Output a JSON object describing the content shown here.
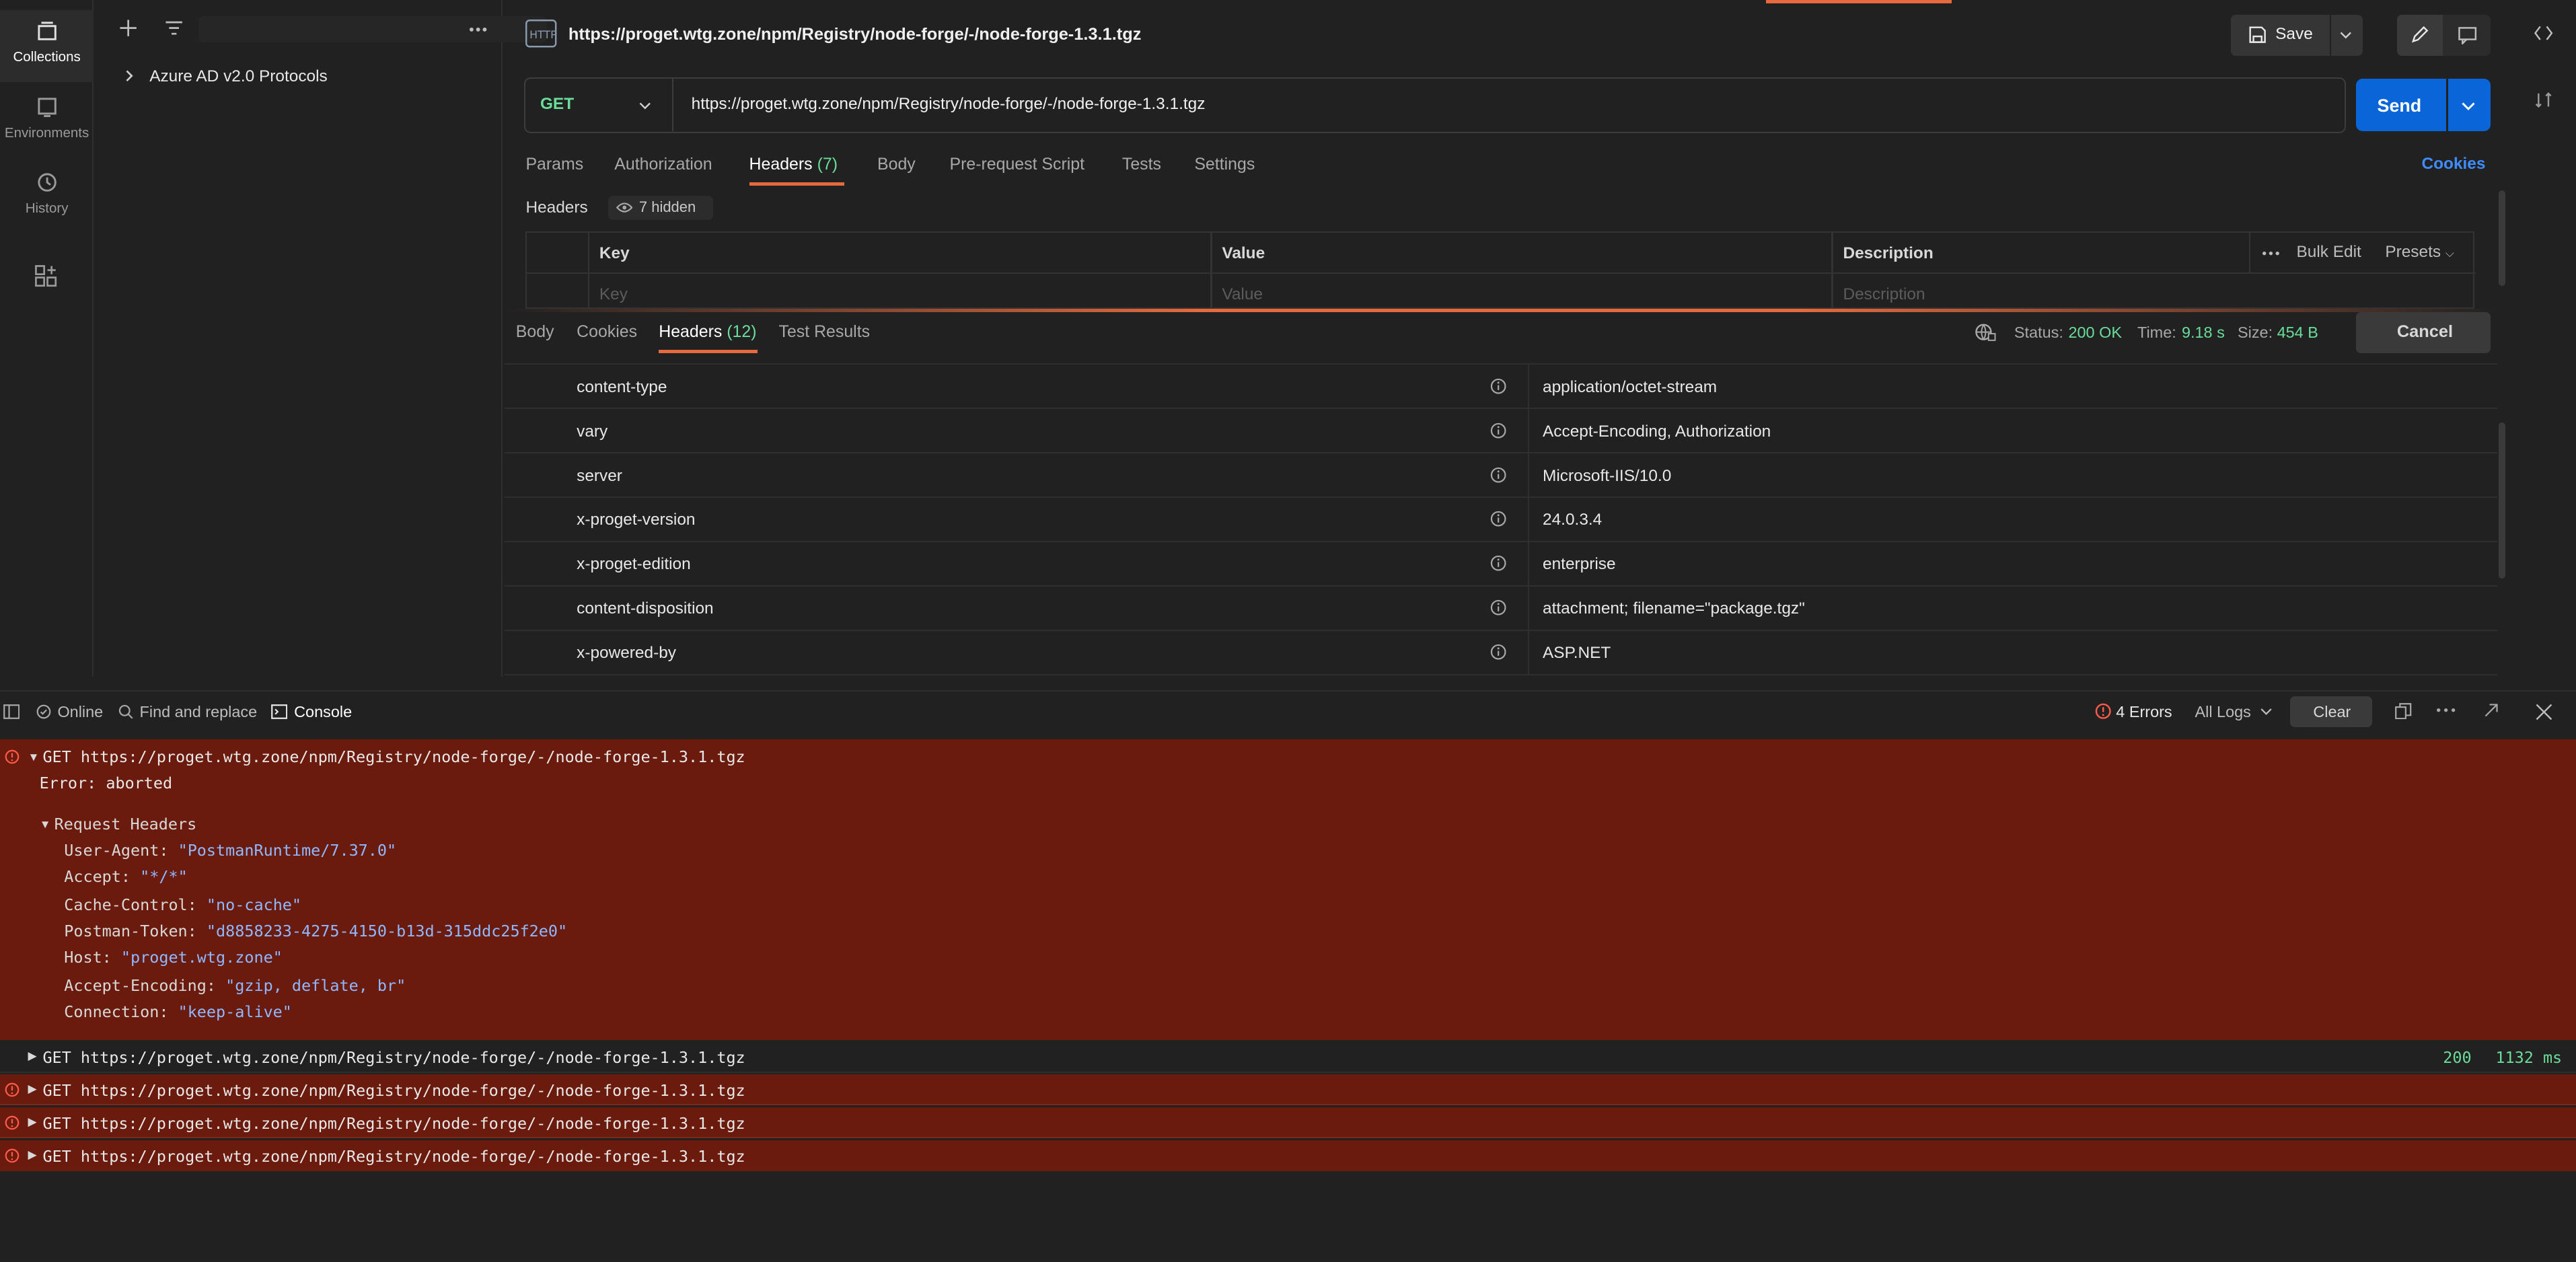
{
  "nav": {
    "items": [
      {
        "label": "Collections",
        "icon": "collections-icon",
        "active": true
      },
      {
        "label": "Environments",
        "icon": "environments-icon",
        "active": false
      },
      {
        "label": "History",
        "icon": "history-icon",
        "active": false
      }
    ]
  },
  "sidebar": {
    "collections": [
      {
        "name": "Azure AD v2.0 Protocols"
      }
    ]
  },
  "request": {
    "title": "https://proget.wtg.zone/npm/Registry/node-forge/-/node-forge-1.3.1.tgz",
    "method": "GET",
    "url": "https://proget.wtg.zone/npm/Registry/node-forge/-/node-forge-1.3.1.tgz",
    "save_label": "Save",
    "send_label": "Send",
    "cookies_label": "Cookies",
    "tabs": [
      {
        "label": "Params"
      },
      {
        "label": "Authorization"
      },
      {
        "label": "Headers",
        "count": "(7)"
      },
      {
        "label": "Body"
      },
      {
        "label": "Pre-request Script"
      },
      {
        "label": "Tests"
      },
      {
        "label": "Settings"
      }
    ],
    "headers_section": {
      "title": "Headers",
      "hidden_label": "7 hidden",
      "columns": {
        "key": "Key",
        "value": "Value",
        "description": "Description"
      },
      "bulk_edit": "Bulk Edit",
      "presets": "Presets",
      "placeholders": {
        "key": "Key",
        "value": "Value",
        "description": "Description"
      }
    }
  },
  "response": {
    "tabs": [
      {
        "label": "Body"
      },
      {
        "label": "Cookies"
      },
      {
        "label": "Headers",
        "count": "(12)"
      },
      {
        "label": "Test Results"
      }
    ],
    "status_label": "Status:",
    "status_value": "200 OK",
    "time_label": "Time:",
    "time_value": "9.18 s",
    "size_label": "Size:",
    "size_value": "454 B",
    "cancel_label": "Cancel",
    "headers": [
      {
        "key": "content-type",
        "value": "application/octet-stream"
      },
      {
        "key": "vary",
        "value": "Accept-Encoding, Authorization"
      },
      {
        "key": "server",
        "value": "Microsoft-IIS/10.0"
      },
      {
        "key": "x-proget-version",
        "value": "24.0.3.4"
      },
      {
        "key": "x-proget-edition",
        "value": "enterprise"
      },
      {
        "key": "content-disposition",
        "value": "attachment; filename=\"package.tgz\""
      },
      {
        "key": "x-powered-by",
        "value": "ASP.NET"
      }
    ]
  },
  "console": {
    "online_label": "Online",
    "find_label": "Find and replace",
    "console_label": "Console",
    "errors_label": "4 Errors",
    "all_logs_label": "All Logs",
    "clear_label": "Clear",
    "expanded": {
      "line": "GET https://proget.wtg.zone/npm/Registry/node-forge/-/node-forge-1.3.1.tgz",
      "error": "Error: aborted",
      "req_headers_label": "Request Headers",
      "headers": [
        {
          "k": "User-Agent:",
          "v": "\"PostmanRuntime/7.37.0\""
        },
        {
          "k": "Accept:",
          "v": "\"*/*\""
        },
        {
          "k": "Cache-Control:",
          "v": "\"no-cache\""
        },
        {
          "k": "Postman-Token:",
          "v": "\"d8858233-4275-4150-b13d-315ddc25f2e0\""
        },
        {
          "k": "Host:",
          "v": "\"proget.wtg.zone\""
        },
        {
          "k": "Accept-Encoding:",
          "v": "\"gzip, deflate, br\""
        },
        {
          "k": "Connection:",
          "v": "\"keep-alive\""
        }
      ]
    },
    "ok_line": {
      "text": "GET https://proget.wtg.zone/npm/Registry/node-forge/-/node-forge-1.3.1.tgz",
      "status": "200",
      "time": "1132 ms"
    },
    "error_lines": [
      "GET https://proget.wtg.zone/npm/Registry/node-forge/-/node-forge-1.3.1.tgz",
      "GET https://proget.wtg.zone/npm/Registry/node-forge/-/node-forge-1.3.1.tgz",
      "GET https://proget.wtg.zone/npm/Registry/node-forge/-/node-forge-1.3.1.tgz"
    ]
  },
  "colors": {
    "accent": "#0a66d8",
    "method": "#6bdd9a",
    "error_bg": "#6b1b0d",
    "tab_underline": "#e66a3d"
  }
}
